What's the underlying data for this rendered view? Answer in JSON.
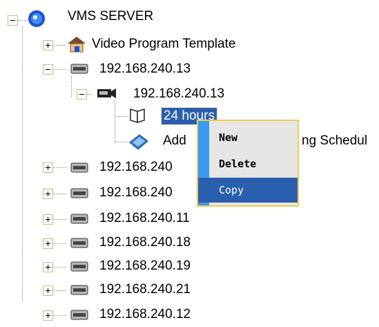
{
  "tree": {
    "root": {
      "label": "VMS SERVER",
      "icon": "globe-icon",
      "state": "expanded"
    },
    "nodes": [
      {
        "label": "Video Program Template",
        "icon": "house-icon",
        "state": "collapsed",
        "level": 1
      },
      {
        "label": "192.168.240.13",
        "icon": "dvr-device-icon",
        "state": "expanded",
        "level": 1
      },
      {
        "label": "192.168.240.13",
        "icon": "camera-icon",
        "state": "expanded",
        "level": 2
      },
      {
        "label": "24 hours",
        "icon": "schedule-book-icon",
        "state": "leaf",
        "level": 3,
        "selected": true
      },
      {
        "label": "Add",
        "suffix": "ng Schedul",
        "icon": "add-schedule-icon",
        "state": "leaf",
        "level": 3
      },
      {
        "label": "192.168.240",
        "icon": "dvr-device-icon",
        "state": "collapsed",
        "level": 1
      },
      {
        "label": "192.168.240",
        "icon": "dvr-device-icon",
        "state": "collapsed",
        "level": 1
      },
      {
        "label": "192.168.240.11",
        "icon": "dvr-device-icon",
        "state": "collapsed",
        "level": 1
      },
      {
        "label": "192.168.240.18",
        "icon": "dvr-device-icon",
        "state": "collapsed",
        "level": 1
      },
      {
        "label": "192.168.240.19",
        "icon": "dvr-device-icon",
        "state": "collapsed",
        "level": 1
      },
      {
        "label": "192.168.240.21",
        "icon": "dvr-device-icon",
        "state": "collapsed",
        "level": 1
      },
      {
        "label": "192.168.240.12",
        "icon": "dvr-device-icon",
        "state": "collapsed",
        "level": 1
      }
    ]
  },
  "context_menu": {
    "items": [
      {
        "label": "New"
      },
      {
        "label": "Delete"
      },
      {
        "label": "Copy",
        "highlighted": true
      }
    ]
  },
  "colors": {
    "selection": "#2a5fad",
    "menu_border": "#f2c94c",
    "menu_gutter": "#3a9af0",
    "menu_bg": "#e6e6e6"
  }
}
